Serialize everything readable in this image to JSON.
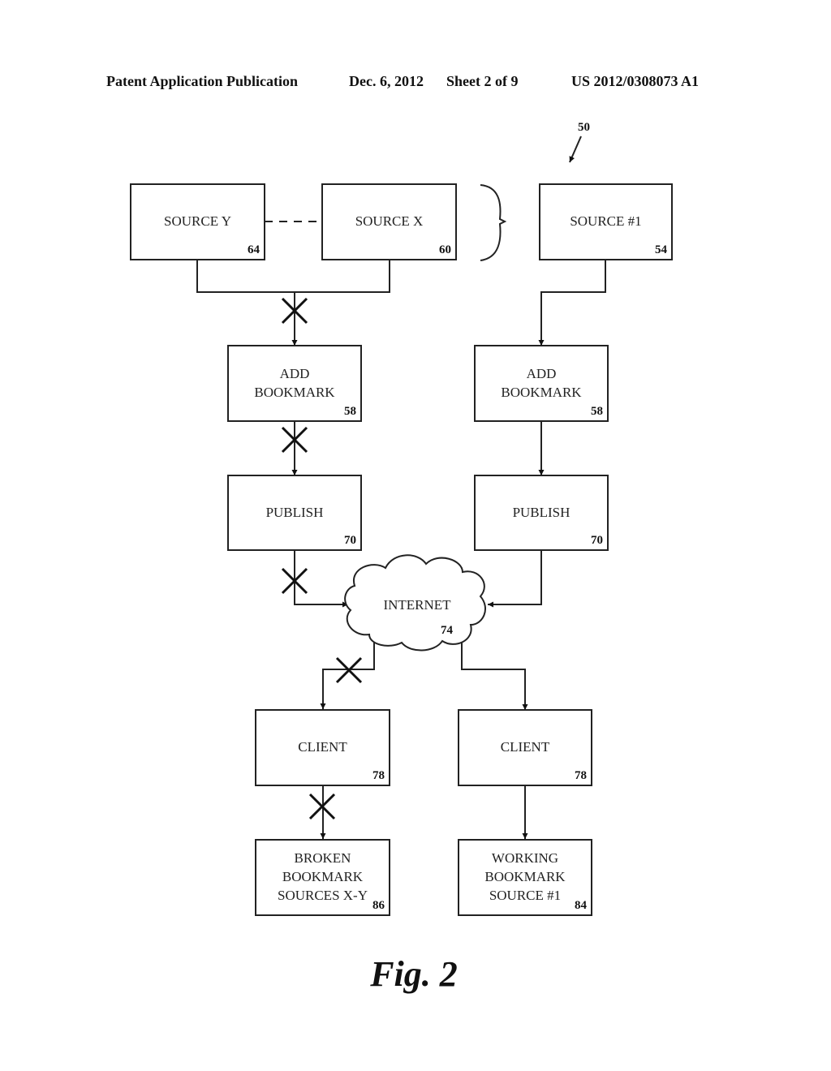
{
  "header": {
    "publication": "Patent Application Publication",
    "date": "Dec. 6, 2012",
    "sheet": "Sheet 2 of 9",
    "number": "US 2012/0308073 A1"
  },
  "figure": {
    "ref": "50",
    "caption": "Fig. 2",
    "nodes": {
      "source_y": {
        "lines": [
          "SOURCE Y"
        ],
        "ref": "64"
      },
      "source_x": {
        "lines": [
          "SOURCE X"
        ],
        "ref": "60"
      },
      "source_1": {
        "lines": [
          "SOURCE #1"
        ],
        "ref": "54"
      },
      "add_bookmark_left": {
        "lines": [
          "ADD",
          "BOOKMARK"
        ],
        "ref": "58"
      },
      "add_bookmark_right": {
        "lines": [
          "ADD",
          "BOOKMARK"
        ],
        "ref": "58"
      },
      "publish_left": {
        "lines": [
          "PUBLISH"
        ],
        "ref": "70"
      },
      "publish_right": {
        "lines": [
          "PUBLISH"
        ],
        "ref": "70"
      },
      "internet": {
        "lines": [
          "INTERNET"
        ],
        "ref": "74"
      },
      "client_left": {
        "lines": [
          "CLIENT"
        ],
        "ref": "78"
      },
      "client_right": {
        "lines": [
          "CLIENT"
        ],
        "ref": "78"
      },
      "broken_bookmark": {
        "lines": [
          "BROKEN",
          "BOOKMARK",
          "SOURCES X-Y"
        ],
        "ref": "86"
      },
      "working_bookmark": {
        "lines": [
          "WORKING",
          "BOOKMARK",
          "SOURCE #1"
        ],
        "ref": "84"
      }
    },
    "edges": [
      {
        "from": "source_y",
        "to": "add_bookmark_left",
        "broken": true
      },
      {
        "from": "source_x",
        "to": "add_bookmark_left",
        "broken": true
      },
      {
        "from": "add_bookmark_left",
        "to": "publish_left",
        "broken": true
      },
      {
        "from": "publish_left",
        "to": "internet",
        "broken": true
      },
      {
        "from": "internet",
        "to": "client_left",
        "broken": true
      },
      {
        "from": "client_left",
        "to": "broken_bookmark",
        "broken": true
      },
      {
        "from": "source_1",
        "to": "add_bookmark_right",
        "broken": false
      },
      {
        "from": "add_bookmark_right",
        "to": "publish_right",
        "broken": false
      },
      {
        "from": "publish_right",
        "to": "internet",
        "broken": false
      },
      {
        "from": "internet",
        "to": "client_right",
        "broken": false
      },
      {
        "from": "client_right",
        "to": "working_bookmark",
        "broken": false
      },
      {
        "from": "source_y",
        "to": "source_x",
        "style": "dashed"
      }
    ]
  }
}
